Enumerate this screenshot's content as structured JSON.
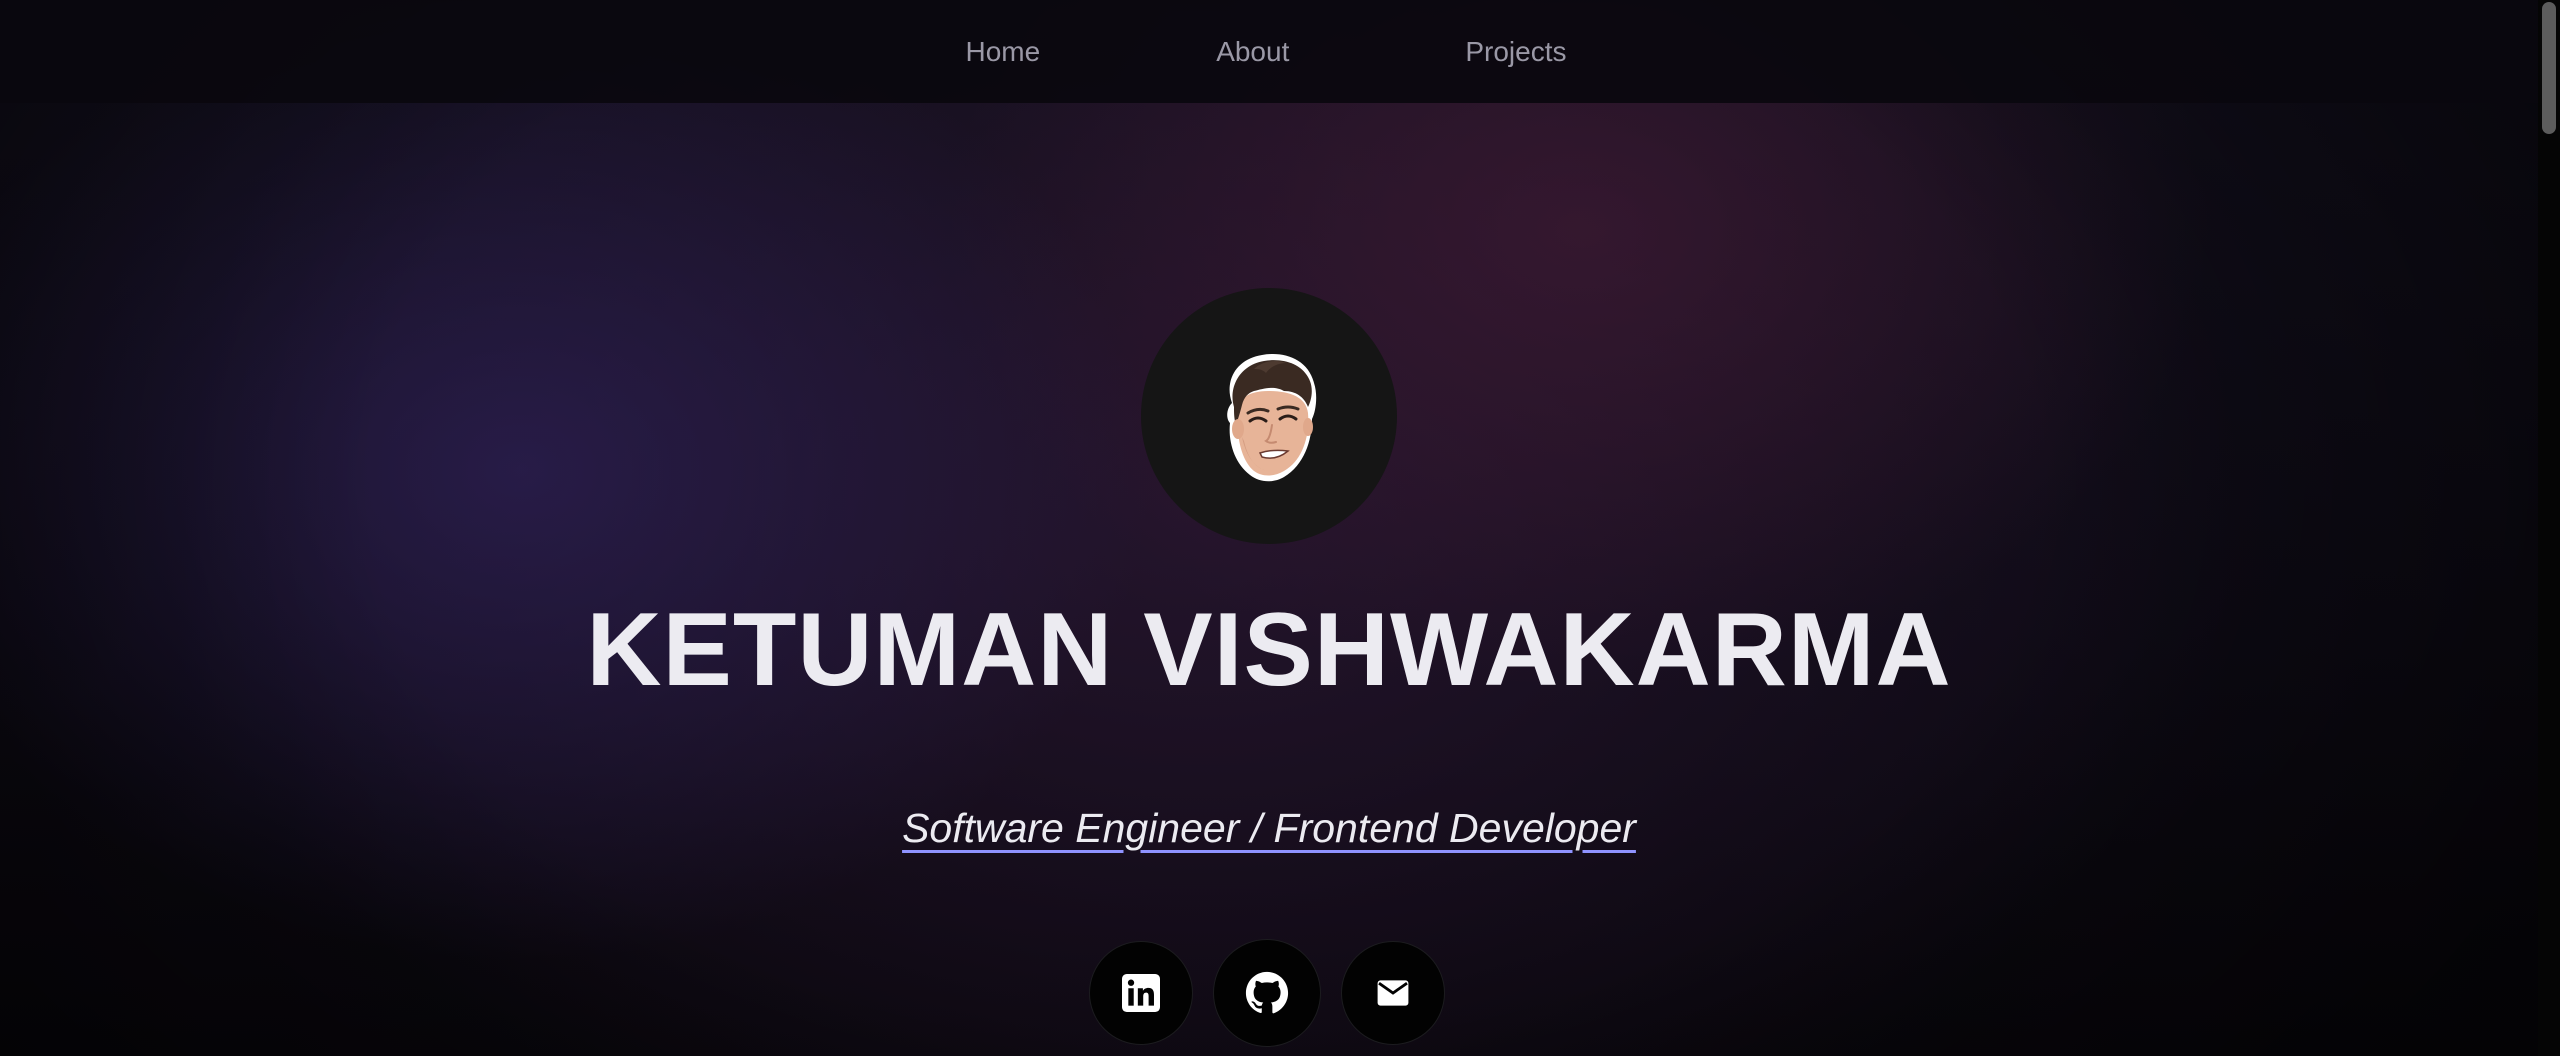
{
  "nav": {
    "links": [
      {
        "label": "Home"
      },
      {
        "label": "About"
      },
      {
        "label": "Projects"
      }
    ]
  },
  "hero": {
    "name": "KETUMAN VISHWAKARMA",
    "subtitle": "Software Engineer / Frontend Developer",
    "avatar_icon": "cartoon-avatar-icon"
  },
  "socials": [
    {
      "icon": "linkedin-icon"
    },
    {
      "icon": "github-icon"
    },
    {
      "icon": "mail-icon"
    }
  ],
  "colors": {
    "text": "#ecebf1",
    "nav_text": "#9a98a6",
    "underline_accent": "#8f93ff",
    "avatar_bg": "#151515",
    "social_bg": "#020202"
  }
}
